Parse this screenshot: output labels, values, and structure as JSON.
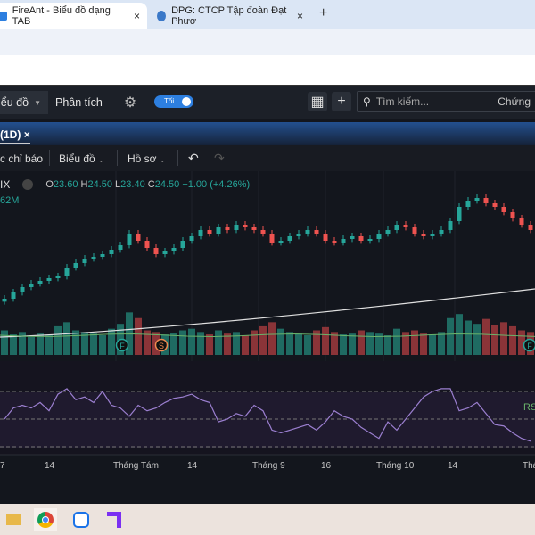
{
  "browser": {
    "tabs": [
      {
        "title": "FireAnt - Biểu đồ dạng TAB",
        "active": true
      },
      {
        "title": "DPG: CTCP Tập đoàn Đạt Phươ",
        "active": false
      }
    ],
    "new_tab": "+",
    "close": "×"
  },
  "toolbar": {
    "chart_menu": "iểu đồ",
    "analysis": "Phân tích",
    "theme_toggle": "Tối",
    "search_placeholder": "Tìm kiếm...",
    "stocks": "Chứng"
  },
  "chart_tab": {
    "label": "(1D)",
    "close": "×"
  },
  "chart_toolbar": {
    "indicators": "c chỉ báo",
    "chart": "Biểu đồ",
    "profile": "Hồ sơ",
    "undo": "↶",
    "redo": "↷"
  },
  "legend": {
    "symbol": "IX",
    "o_label": "O",
    "o": "23.60",
    "h_label": "H",
    "h": "24.50",
    "l_label": "L",
    "l": "23.40",
    "c_label": "C",
    "c": "24.50",
    "change": "+1.00 (+4.26%)",
    "volume": "62M"
  },
  "rsi_label": "RS",
  "colors": {
    "up": "#26a69a",
    "down": "#ef5350",
    "rsi": "#9b7fd0",
    "ma": "#e0e0e0",
    "vol_ma": "#6ab36a",
    "accent": "#2d7fe0"
  },
  "chart_data": {
    "type": "candlestick",
    "x_ticks": [
      "7",
      "14",
      "Tháng Tám",
      "14",
      "Tháng 9",
      "16",
      "Tháng 10",
      "14",
      "Thá"
    ],
    "close": [
      21.35,
      21.56,
      21.74,
      21.86,
      21.95,
      22.04,
      22.1,
      22.4,
      22.55,
      22.7,
      22.76,
      22.85,
      23.0,
      23.15,
      23.54,
      23.3,
      23.06,
      22.85,
      22.94,
      23.06,
      23.3,
      23.45,
      23.66,
      23.54,
      23.75,
      23.66,
      23.84,
      23.75,
      23.66,
      23.54,
      23.24,
      23.3,
      23.45,
      23.54,
      23.66,
      23.54,
      23.3,
      23.24,
      23.36,
      23.45,
      23.3,
      23.36,
      23.54,
      23.66,
      23.84,
      23.75,
      23.54,
      23.45,
      23.54,
      23.66,
      23.96,
      24.44,
      24.65,
      24.74,
      24.56,
      24.44,
      24.26,
      24.05,
      23.84,
      23.66
    ],
    "volume": [
      30,
      25,
      28,
      22,
      26,
      24,
      35,
      40,
      30,
      28,
      26,
      24,
      32,
      38,
      52,
      45,
      30,
      28,
      25,
      27,
      30,
      32,
      28,
      25,
      30,
      26,
      28,
      24,
      30,
      35,
      40,
      32,
      28,
      26,
      24,
      30,
      34,
      28,
      25,
      26,
      30,
      28,
      26,
      24,
      32,
      28,
      30,
      26,
      25,
      28,
      45,
      50,
      42,
      38,
      44,
      36,
      40,
      35,
      30,
      28
    ],
    "rsi": [
      50,
      58,
      60,
      58,
      62,
      56,
      68,
      72,
      64,
      66,
      62,
      70,
      60,
      58,
      52,
      60,
      56,
      58,
      62,
      65,
      66,
      68,
      64,
      62,
      48,
      50,
      54,
      52,
      60,
      56,
      42,
      40,
      42,
      44,
      46,
      42,
      48,
      56,
      52,
      50,
      44,
      40,
      36,
      48,
      42,
      50,
      58,
      66,
      70,
      72,
      72,
      56,
      58,
      62,
      54,
      46,
      45,
      40,
      36,
      34
    ],
    "rsi_levels": [
      70,
      50,
      30
    ],
    "markers": [
      "F",
      "S",
      "F"
    ]
  }
}
